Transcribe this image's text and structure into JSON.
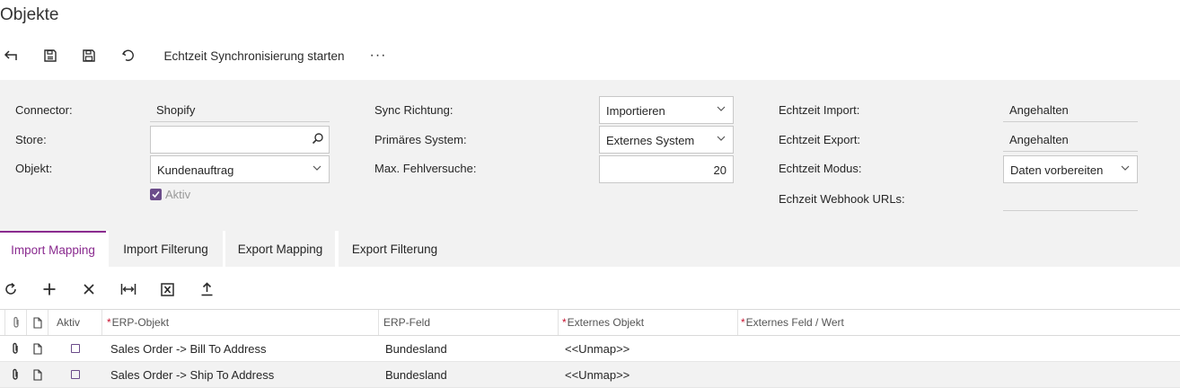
{
  "page": {
    "title": "Objekte"
  },
  "toolbar": {
    "back_icon": "undo-arrow-icon",
    "save_close_icon": "save-close-icon",
    "save_icon": "save-icon",
    "reset_icon": "reset-icon",
    "sync_label": "Echtzeit Synchronisierung starten",
    "more_label": "···"
  },
  "form": {
    "connector_label": "Connector:",
    "connector_value": "Shopify",
    "store_label": "Store:",
    "store_value": "",
    "objekt_label": "Objekt:",
    "objekt_value": "Kundenauftrag",
    "aktiv_label": "Aktiv",
    "aktiv_checked": true,
    "sync_richtung_label": "Sync Richtung:",
    "sync_richtung_value": "Importieren",
    "primaeres_label": "Primäres System:",
    "primaeres_value": "Externes System",
    "max_fehl_label": "Max. Fehlversuche:",
    "max_fehl_value": "20",
    "echtzeit_import_label": "Echtzeit Import:",
    "echtzeit_import_value": "Angehalten",
    "echtzeit_export_label": "Echtzeit Export:",
    "echtzeit_export_value": "Angehalten",
    "echtzeit_modus_label": "Echtzeit Modus:",
    "echtzeit_modus_value": "Daten vorbereiten",
    "webhook_label": "Echzeit Webhook URLs:",
    "webhook_value": ""
  },
  "tabs": [
    {
      "label": "Import Mapping",
      "active": true
    },
    {
      "label": "Import Filterung",
      "active": false
    },
    {
      "label": "Export Mapping",
      "active": false
    },
    {
      "label": "Export Filterung",
      "active": false
    }
  ],
  "grid": {
    "columns": {
      "aktiv": "Aktiv",
      "erp_objekt": "ERP-Objekt",
      "erp_feld": "ERP-Feld",
      "externes_objekt": "Externes Objekt",
      "externes_feld": "Externes Feld / Wert"
    },
    "rows": [
      {
        "aktiv": false,
        "erp_objekt": "Sales Order -> Bill To Address",
        "erp_feld": "Bundesland",
        "externes_objekt": "<<Unmap>>",
        "externes_feld": ""
      },
      {
        "aktiv": false,
        "erp_objekt": "Sales Order -> Ship To Address",
        "erp_feld": "Bundesland",
        "externes_objekt": "<<Unmap>>",
        "externes_feld": ""
      }
    ]
  },
  "colors": {
    "accent": "#8a2b8f",
    "checkbox": "#6b4c8a",
    "required": "#c8102e",
    "panel_bg": "#f2f2f2"
  }
}
